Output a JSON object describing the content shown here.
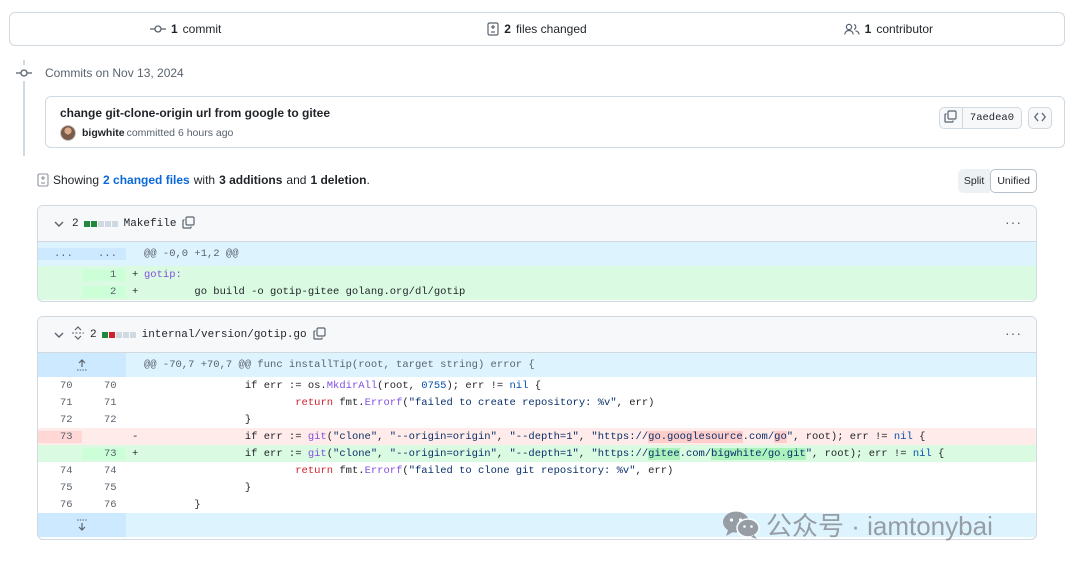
{
  "summary": {
    "commits_count": "1",
    "commits_label": "commit",
    "files_count": "2",
    "files_label": "files changed",
    "contributors_count": "1",
    "contributors_label": "contributor"
  },
  "timeline": {
    "date_label": "Commits on Nov 13, 2024"
  },
  "commit": {
    "title": "change git-clone-origin url from google to gitee",
    "author": "bigwhite",
    "meta": "committed 6 hours ago",
    "sha": "7aedea0"
  },
  "showing": {
    "prefix": "Showing",
    "changed_files": "2 changed files",
    "with": "with",
    "additions": "3 additions",
    "and": "and",
    "deletions": "1 deletion",
    "period": "."
  },
  "view": {
    "split_label": "Split",
    "unified_label": "Unified"
  },
  "files": [
    {
      "count": "2",
      "name": "Makefile",
      "hunk": "@@ -0,0 +1,2 @@",
      "hunk_left": "...",
      "hunk_right": "...",
      "lines": [
        {
          "new": "1",
          "sign": "+",
          "text": "gotip:"
        },
        {
          "new": "2",
          "sign": "+",
          "text": "        go build -o gotip-gitee golang.org/dl/gotip"
        }
      ]
    },
    {
      "count": "2",
      "name": "internal/version/gotip.go",
      "hunk": "@@ -70,7 +70,7 @@ func installTip(root, target string) error {",
      "lines": [
        {
          "old": "70",
          "new": "70",
          "sign": "",
          "type": "ctx"
        },
        {
          "old": "71",
          "new": "71",
          "sign": "",
          "type": "ctx"
        },
        {
          "old": "72",
          "new": "72",
          "sign": "",
          "type": "ctx"
        },
        {
          "old": "73",
          "new": "",
          "sign": "-",
          "type": "del"
        },
        {
          "old": "",
          "new": "73",
          "sign": "+",
          "type": "add"
        },
        {
          "old": "74",
          "new": "74",
          "sign": "",
          "type": "ctx"
        },
        {
          "old": "75",
          "new": "75",
          "sign": "",
          "type": "ctx"
        },
        {
          "old": "76",
          "new": "76",
          "sign": "",
          "type": "ctx"
        }
      ],
      "code": {
        "l70_a": "                if err := os.",
        "l70_fn": "MkdirAll",
        "l70_b": "(root, ",
        "l70_num": "0755",
        "l70_c": "); err != ",
        "l70_nil": "nil",
        "l70_d": " {",
        "l71_a": "                        ",
        "l71_ret": "return",
        "l71_b": " fmt.",
        "l71_fn": "Errorf",
        "l71_c": "(",
        "l71_str": "\"failed to create repository: %v\"",
        "l71_d": ", err)",
        "l72": "                }",
        "l73d_a": "                if err := ",
        "l73d_fn": "git",
        "l73d_b": "(",
        "l73d_s1": "\"clone\"",
        "l73d_c1": ", ",
        "l73d_s2": "\"--origin=origin\"",
        "l73d_c2": ", ",
        "l73d_s3": "\"--depth=1\"",
        "l73d_c3": ", ",
        "l73d_s4a": "\"https://",
        "l73d_hl1": "go.googlesource",
        "l73d_s4b": ".com/",
        "l73d_hl2": "go",
        "l73d_s4c": "\"",
        "l73d_e": ", root); err != ",
        "l73d_nil": "nil",
        "l73d_f": " {",
        "l73a_a": "                if err := ",
        "l73a_fn": "git",
        "l73a_b": "(",
        "l73a_s1": "\"clone\"",
        "l73a_c1": ", ",
        "l73a_s2": "\"--origin=origin\"",
        "l73a_c2": ", ",
        "l73a_s3": "\"--depth=1\"",
        "l73a_c3": ", ",
        "l73a_s4a": "\"https://",
        "l73a_hl1": "gitee",
        "l73a_s4b": ".com/",
        "l73a_hl2": "bigwhite/go.git",
        "l73a_s4c": "\"",
        "l73a_e": ", root); err != ",
        "l73a_nil": "nil",
        "l73a_f": " {",
        "l74_a": "                        ",
        "l74_ret": "return",
        "l74_b": " fmt.",
        "l74_fn": "Errorf",
        "l74_c": "(",
        "l74_str": "\"failed to clone git repository: %v\"",
        "l74_d": ", err)",
        "l75": "                }",
        "l76": "        }"
      }
    }
  ],
  "watermark": "公众号 · iamtonybai",
  "colors": {
    "accent": "#0969da",
    "addition": "#1f883d",
    "deletion": "#cf222e",
    "hunk_bg": "#ddf4ff"
  }
}
